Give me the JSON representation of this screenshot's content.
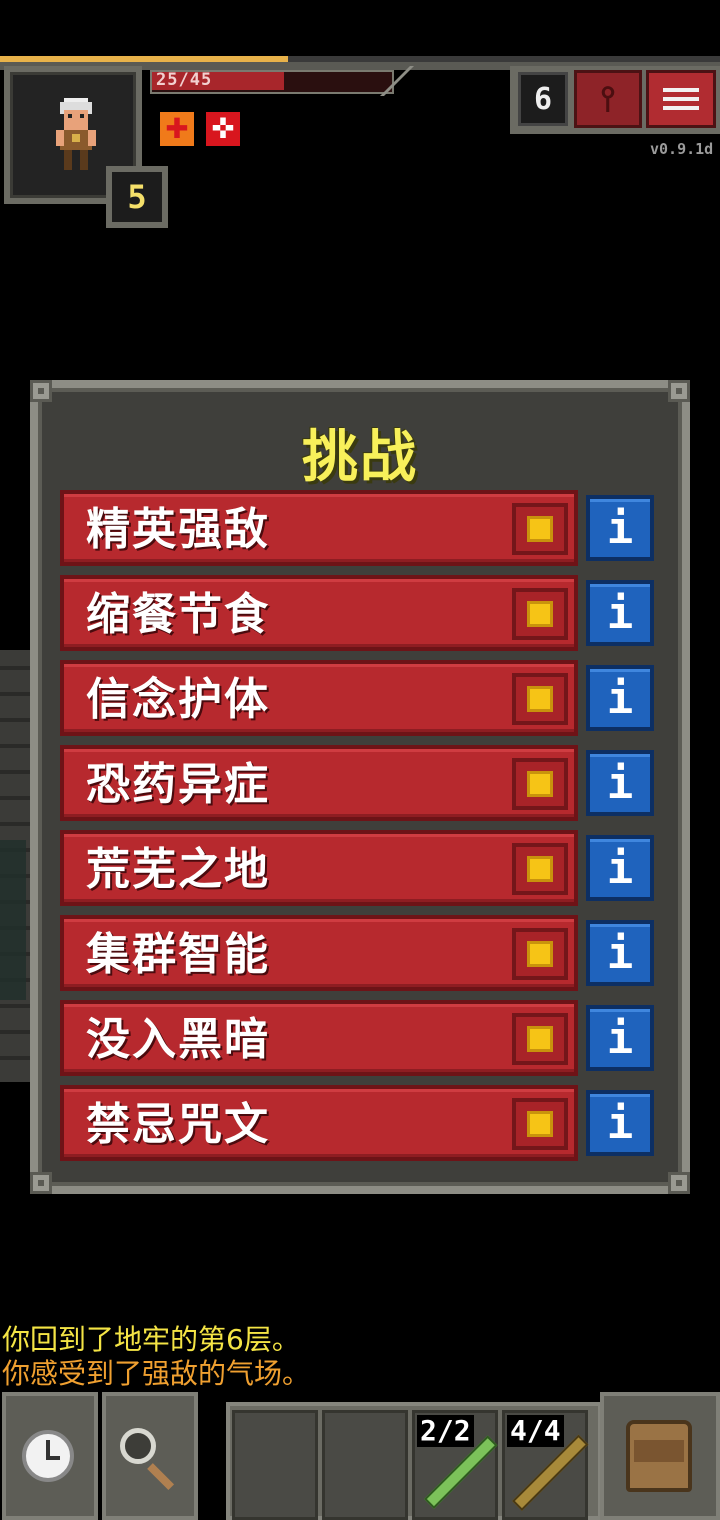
{
  "hud": {
    "hp_text": "25/45",
    "hp_fraction": 0.5556,
    "hero_level": "5",
    "depth": "6",
    "version": "v0.9.1d",
    "buffs": [
      "plus-icon",
      "cross-icon"
    ]
  },
  "dialog": {
    "title": "挑战",
    "challenges": [
      {
        "label": "精英强敌",
        "checked": true
      },
      {
        "label": "缩餐节食",
        "checked": true
      },
      {
        "label": "信念护体",
        "checked": true
      },
      {
        "label": "恐药异症",
        "checked": true
      },
      {
        "label": "荒芜之地",
        "checked": true
      },
      {
        "label": "集群智能",
        "checked": true
      },
      {
        "label": "没入黑暗",
        "checked": true
      },
      {
        "label": "禁忌咒文",
        "checked": true
      }
    ],
    "info_label": "i"
  },
  "log": {
    "line1": "你回到了地牢的第6层。",
    "line2": "你感受到了强敌的气场。"
  },
  "toolbar": {
    "slot3_charges": "2/2",
    "slot4_charges": "4/4"
  },
  "colors": {
    "title": "#f8f05a",
    "row": "#b7292e",
    "info": "#1f63bd",
    "log_yellow": "#f4e445",
    "log_orange": "#f0a030"
  }
}
